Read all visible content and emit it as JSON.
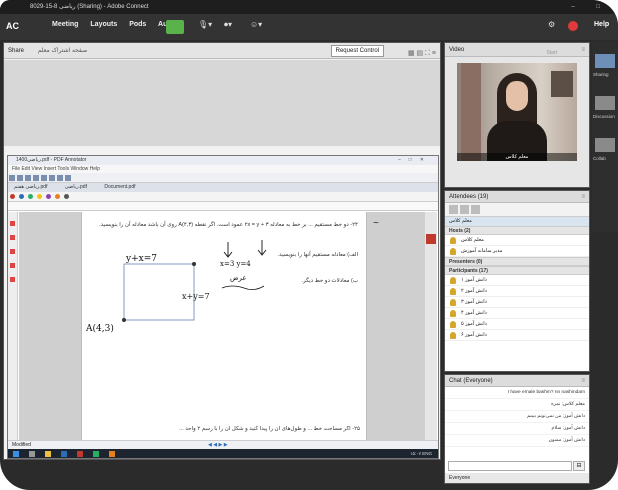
{
  "window": {
    "title": "ریاضی 8-15-8029 (Sharing) - Adobe Connect",
    "controls": "– □"
  },
  "menubar": {
    "logo": "AC",
    "items": [
      "Meeting",
      "Layouts",
      "Pods",
      "Audio"
    ],
    "help": "Help"
  },
  "share_pod": {
    "title": "Share",
    "subtitle": "صفحه اشتراک معلم",
    "request_control": "Request Control"
  },
  "editor": {
    "title": "ریاضی1400.pdf - PDF Annotator",
    "menu": "File  Edit  View  Insert  Tools  Window  Help",
    "tabs": [
      "ریاضی هفتم.pdf",
      "ریاضی.pdf",
      "Document.pdf"
    ],
    "status": "Modified",
    "handwriting": {
      "eq1": "y+x=7",
      "eq2": "x+y=7",
      "point": "A(4,3)",
      "marks": "x=3 y=4",
      "note": "عرض"
    },
    "question_line1": "۲۴- دو خط مستقیم ... بر خط به معادله ۳ + ۲x = y عمود است. اگر نقطه A(۴,۳) روی آن باشد معادله آن را بنویسید.",
    "question_line2": "الف) معادله مستقیم آنها را بنویسید.",
    "question_line3": "ب) معادلات دو خط دیگر.",
    "question_line4": "۲۵- اگر مساحت خط ... و طول‌های آن را پیدا کنید و شکل آن را با رسم ۲ واحد ...",
    "taskbar_right": "۱۵:۰۷  ENG"
  },
  "video_pod": {
    "title": "Video",
    "start_label": "Start",
    "caption": "معلم کلاس"
  },
  "sidebar": {
    "labels": [
      "Sharing",
      "Discussion",
      "Collab"
    ]
  },
  "attendees": {
    "title": "Attendees (19)",
    "active_speaker": "معلم کلاس",
    "groups": {
      "hosts": "Hosts (2)",
      "presenters": "Presenters (0)",
      "participants": "Participants (17)"
    },
    "hosts": [
      "معلم کلاس",
      "مدیر سامانه آموزش"
    ],
    "participants": [
      "دانش آموز ۱",
      "دانش آموز ۲",
      "دانش آموز ۳",
      "دانش آموز ۴",
      "دانش آموز ۵",
      "دانش آموز ۶"
    ]
  },
  "chat": {
    "title": "Chat (Everyone)",
    "messages": [
      "I have emale bashm? nn nashindam",
      "معلم کلاس: نمره",
      "دانش آموز: من نمی‌تونم ببینم",
      "دانش آموز: سلام",
      "دانش آموز: ممنون"
    ],
    "footer": "Everyone"
  },
  "colors": {
    "accent_green": "#5ab24a",
    "status_red": "#e03a3a",
    "chrome": "#333333"
  }
}
